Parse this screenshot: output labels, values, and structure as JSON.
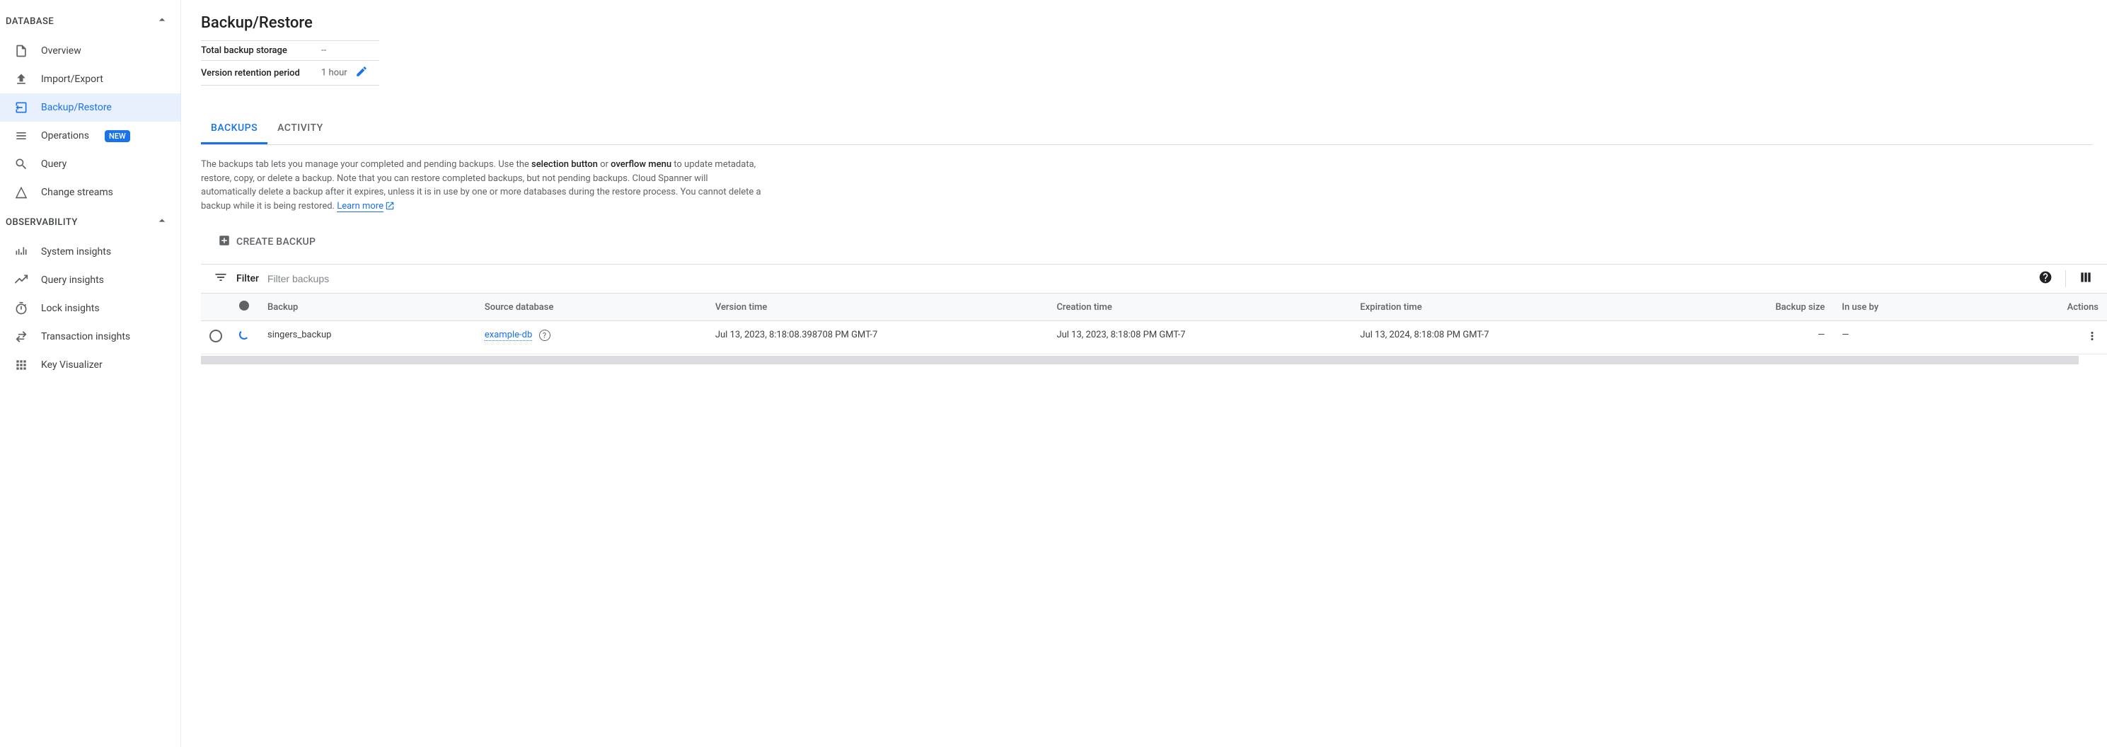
{
  "sidebar": {
    "sections": [
      {
        "title": "DATABASE",
        "items": [
          {
            "label": "Overview",
            "icon": "overview"
          },
          {
            "label": "Import/Export",
            "icon": "import-export"
          },
          {
            "label": "Backup/Restore",
            "icon": "backup-restore",
            "active": true
          },
          {
            "label": "Operations",
            "icon": "operations",
            "badge": "NEW"
          },
          {
            "label": "Query",
            "icon": "query"
          },
          {
            "label": "Change streams",
            "icon": "change-streams"
          }
        ]
      },
      {
        "title": "OBSERVABILITY",
        "items": [
          {
            "label": "System insights",
            "icon": "system"
          },
          {
            "label": "Query insights",
            "icon": "query-insights"
          },
          {
            "label": "Lock insights",
            "icon": "lock"
          },
          {
            "label": "Transaction insights",
            "icon": "transaction"
          },
          {
            "label": "Key Visualizer",
            "icon": "key-viz"
          }
        ]
      }
    ]
  },
  "page": {
    "title": "Backup/Restore"
  },
  "meta": {
    "total_storage_label": "Total backup storage",
    "total_storage_value": "--",
    "retention_label": "Version retention period",
    "retention_value": "1 hour"
  },
  "tabs": {
    "backups": "BACKUPS",
    "activity": "ACTIVITY"
  },
  "description": {
    "part1": "The backups tab lets you manage your completed and pending backups. Use the ",
    "bold1": "selection button",
    "part2": " or ",
    "bold2": "overflow menu",
    "part3": " to update metadata, restore, copy, or delete a backup. Note that you can restore completed backups, but not pending backups. Cloud Spanner will automatically delete a backup after it expires, unless it is in use by one or more databases during the restore process. You cannot delete a backup while it is being restored. ",
    "learn_more": "Learn more"
  },
  "create_button": "CREATE BACKUP",
  "filter": {
    "label": "Filter",
    "placeholder": "Filter backups"
  },
  "table": {
    "headers": {
      "backup": "Backup",
      "source": "Source database",
      "version": "Version time",
      "creation": "Creation time",
      "expiration": "Expiration time",
      "size": "Backup size",
      "inuse": "In use by",
      "actions": "Actions"
    },
    "rows": [
      {
        "backup": "singers_backup",
        "source": "example-db",
        "version": "Jul 13, 2023, 8:18:08.398708 PM GMT-7",
        "creation": "Jul 13, 2023, 8:18:08 PM GMT-7",
        "expiration": "Jul 13, 2024, 8:18:08 PM GMT-7",
        "size": "—",
        "inuse": "—"
      }
    ]
  }
}
